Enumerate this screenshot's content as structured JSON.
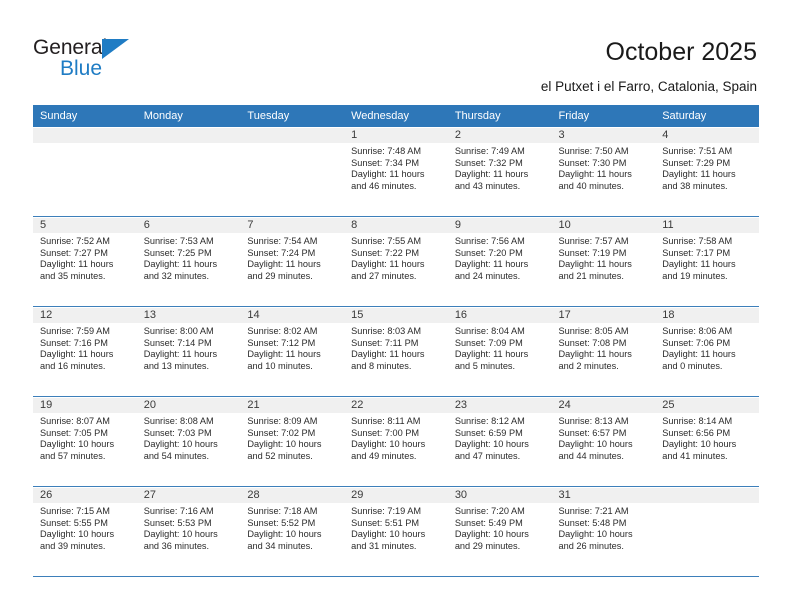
{
  "brand": {
    "name_part1": "General",
    "name_part2": "Blue",
    "triangle_color": "#1f7cc4"
  },
  "header": {
    "title": "October 2025",
    "subtitle": "el Putxet i el Farro, Catalonia, Spain"
  },
  "colors": {
    "header_blue": "#2e77b8",
    "row_divider": "#3d7fba",
    "date_band": "#f0f0f0"
  },
  "weekday_headers": [
    "Sunday",
    "Monday",
    "Tuesday",
    "Wednesday",
    "Thursday",
    "Friday",
    "Saturday"
  ],
  "labels": {
    "sunrise_prefix": "Sunrise:",
    "sunset_prefix": "Sunset:",
    "daylight_prefix": "Daylight:"
  },
  "weeks": [
    [
      {
        "day": "",
        "empty": true
      },
      {
        "day": "",
        "empty": true
      },
      {
        "day": "",
        "empty": true
      },
      {
        "day": "1",
        "sunrise": "Sunrise: 7:48 AM",
        "sunset": "Sunset: 7:34 PM",
        "daylight_l1": "Daylight: 11 hours",
        "daylight_l2": "and 46 minutes."
      },
      {
        "day": "2",
        "sunrise": "Sunrise: 7:49 AM",
        "sunset": "Sunset: 7:32 PM",
        "daylight_l1": "Daylight: 11 hours",
        "daylight_l2": "and 43 minutes."
      },
      {
        "day": "3",
        "sunrise": "Sunrise: 7:50 AM",
        "sunset": "Sunset: 7:30 PM",
        "daylight_l1": "Daylight: 11 hours",
        "daylight_l2": "and 40 minutes."
      },
      {
        "day": "4",
        "sunrise": "Sunrise: 7:51 AM",
        "sunset": "Sunset: 7:29 PM",
        "daylight_l1": "Daylight: 11 hours",
        "daylight_l2": "and 38 minutes."
      }
    ],
    [
      {
        "day": "5",
        "sunrise": "Sunrise: 7:52 AM",
        "sunset": "Sunset: 7:27 PM",
        "daylight_l1": "Daylight: 11 hours",
        "daylight_l2": "and 35 minutes."
      },
      {
        "day": "6",
        "sunrise": "Sunrise: 7:53 AM",
        "sunset": "Sunset: 7:25 PM",
        "daylight_l1": "Daylight: 11 hours",
        "daylight_l2": "and 32 minutes."
      },
      {
        "day": "7",
        "sunrise": "Sunrise: 7:54 AM",
        "sunset": "Sunset: 7:24 PM",
        "daylight_l1": "Daylight: 11 hours",
        "daylight_l2": "and 29 minutes."
      },
      {
        "day": "8",
        "sunrise": "Sunrise: 7:55 AM",
        "sunset": "Sunset: 7:22 PM",
        "daylight_l1": "Daylight: 11 hours",
        "daylight_l2": "and 27 minutes."
      },
      {
        "day": "9",
        "sunrise": "Sunrise: 7:56 AM",
        "sunset": "Sunset: 7:20 PM",
        "daylight_l1": "Daylight: 11 hours",
        "daylight_l2": "and 24 minutes."
      },
      {
        "day": "10",
        "sunrise": "Sunrise: 7:57 AM",
        "sunset": "Sunset: 7:19 PM",
        "daylight_l1": "Daylight: 11 hours",
        "daylight_l2": "and 21 minutes."
      },
      {
        "day": "11",
        "sunrise": "Sunrise: 7:58 AM",
        "sunset": "Sunset: 7:17 PM",
        "daylight_l1": "Daylight: 11 hours",
        "daylight_l2": "and 19 minutes."
      }
    ],
    [
      {
        "day": "12",
        "sunrise": "Sunrise: 7:59 AM",
        "sunset": "Sunset: 7:16 PM",
        "daylight_l1": "Daylight: 11 hours",
        "daylight_l2": "and 16 minutes."
      },
      {
        "day": "13",
        "sunrise": "Sunrise: 8:00 AM",
        "sunset": "Sunset: 7:14 PM",
        "daylight_l1": "Daylight: 11 hours",
        "daylight_l2": "and 13 minutes."
      },
      {
        "day": "14",
        "sunrise": "Sunrise: 8:02 AM",
        "sunset": "Sunset: 7:12 PM",
        "daylight_l1": "Daylight: 11 hours",
        "daylight_l2": "and 10 minutes."
      },
      {
        "day": "15",
        "sunrise": "Sunrise: 8:03 AM",
        "sunset": "Sunset: 7:11 PM",
        "daylight_l1": "Daylight: 11 hours",
        "daylight_l2": "and 8 minutes."
      },
      {
        "day": "16",
        "sunrise": "Sunrise: 8:04 AM",
        "sunset": "Sunset: 7:09 PM",
        "daylight_l1": "Daylight: 11 hours",
        "daylight_l2": "and 5 minutes."
      },
      {
        "day": "17",
        "sunrise": "Sunrise: 8:05 AM",
        "sunset": "Sunset: 7:08 PM",
        "daylight_l1": "Daylight: 11 hours",
        "daylight_l2": "and 2 minutes."
      },
      {
        "day": "18",
        "sunrise": "Sunrise: 8:06 AM",
        "sunset": "Sunset: 7:06 PM",
        "daylight_l1": "Daylight: 11 hours",
        "daylight_l2": "and 0 minutes."
      }
    ],
    [
      {
        "day": "19",
        "sunrise": "Sunrise: 8:07 AM",
        "sunset": "Sunset: 7:05 PM",
        "daylight_l1": "Daylight: 10 hours",
        "daylight_l2": "and 57 minutes."
      },
      {
        "day": "20",
        "sunrise": "Sunrise: 8:08 AM",
        "sunset": "Sunset: 7:03 PM",
        "daylight_l1": "Daylight: 10 hours",
        "daylight_l2": "and 54 minutes."
      },
      {
        "day": "21",
        "sunrise": "Sunrise: 8:09 AM",
        "sunset": "Sunset: 7:02 PM",
        "daylight_l1": "Daylight: 10 hours",
        "daylight_l2": "and 52 minutes."
      },
      {
        "day": "22",
        "sunrise": "Sunrise: 8:11 AM",
        "sunset": "Sunset: 7:00 PM",
        "daylight_l1": "Daylight: 10 hours",
        "daylight_l2": "and 49 minutes."
      },
      {
        "day": "23",
        "sunrise": "Sunrise: 8:12 AM",
        "sunset": "Sunset: 6:59 PM",
        "daylight_l1": "Daylight: 10 hours",
        "daylight_l2": "and 47 minutes."
      },
      {
        "day": "24",
        "sunrise": "Sunrise: 8:13 AM",
        "sunset": "Sunset: 6:57 PM",
        "daylight_l1": "Daylight: 10 hours",
        "daylight_l2": "and 44 minutes."
      },
      {
        "day": "25",
        "sunrise": "Sunrise: 8:14 AM",
        "sunset": "Sunset: 6:56 PM",
        "daylight_l1": "Daylight: 10 hours",
        "daylight_l2": "and 41 minutes."
      }
    ],
    [
      {
        "day": "26",
        "sunrise": "Sunrise: 7:15 AM",
        "sunset": "Sunset: 5:55 PM",
        "daylight_l1": "Daylight: 10 hours",
        "daylight_l2": "and 39 minutes."
      },
      {
        "day": "27",
        "sunrise": "Sunrise: 7:16 AM",
        "sunset": "Sunset: 5:53 PM",
        "daylight_l1": "Daylight: 10 hours",
        "daylight_l2": "and 36 minutes."
      },
      {
        "day": "28",
        "sunrise": "Sunrise: 7:18 AM",
        "sunset": "Sunset: 5:52 PM",
        "daylight_l1": "Daylight: 10 hours",
        "daylight_l2": "and 34 minutes."
      },
      {
        "day": "29",
        "sunrise": "Sunrise: 7:19 AM",
        "sunset": "Sunset: 5:51 PM",
        "daylight_l1": "Daylight: 10 hours",
        "daylight_l2": "and 31 minutes."
      },
      {
        "day": "30",
        "sunrise": "Sunrise: 7:20 AM",
        "sunset": "Sunset: 5:49 PM",
        "daylight_l1": "Daylight: 10 hours",
        "daylight_l2": "and 29 minutes."
      },
      {
        "day": "31",
        "sunrise": "Sunrise: 7:21 AM",
        "sunset": "Sunset: 5:48 PM",
        "daylight_l1": "Daylight: 10 hours",
        "daylight_l2": "and 26 minutes."
      },
      {
        "day": "",
        "empty": true
      }
    ]
  ]
}
